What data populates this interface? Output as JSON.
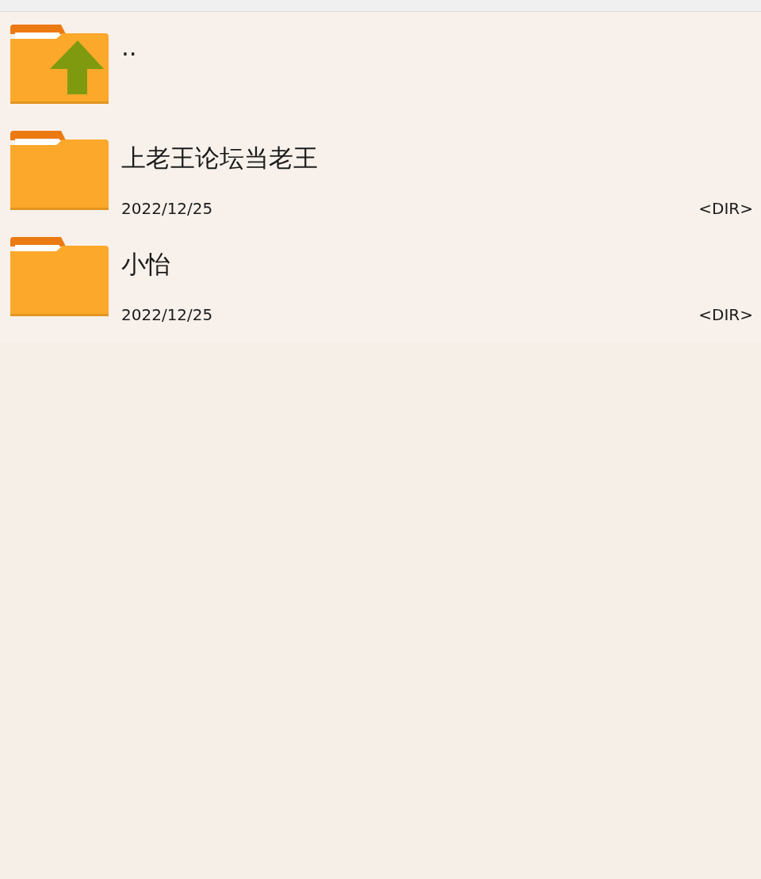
{
  "files": [
    {
      "kind": "parent",
      "name": ".."
    },
    {
      "kind": "folder",
      "name": "上老王论坛当老王",
      "date": "2022/12/25",
      "size": "<DIR>"
    },
    {
      "kind": "folder",
      "name": "小怡",
      "date": "2022/12/25",
      "size": "<DIR>"
    }
  ]
}
